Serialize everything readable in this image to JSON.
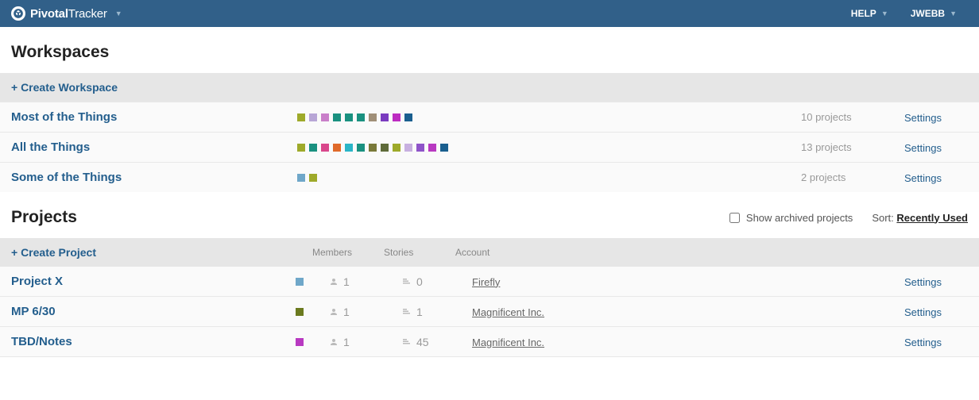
{
  "topbar": {
    "brand_bold": "Pivotal",
    "brand_light": "Tracker",
    "help_label": "HELP",
    "user_label": "JWEBB"
  },
  "workspaces": {
    "title": "Workspaces",
    "create_label": "+ Create Workspace",
    "settings_label": "Settings",
    "rows": [
      {
        "name": "Most of the Things",
        "count_text": "10 projects",
        "colors": [
          "#9eaa2a",
          "#b8a6d6",
          "#c97fc9",
          "#1a9180",
          "#1a9180",
          "#1a9180",
          "#a08f78",
          "#7a3bbf",
          "#bd2cc1",
          "#1a5f8f"
        ]
      },
      {
        "name": "All the Things",
        "count_text": "13 projects",
        "colors": [
          "#9eaa2a",
          "#1a9180",
          "#d9478c",
          "#e06a2b",
          "#2ab5c7",
          "#1a9180",
          "#7a7a3a",
          "#5f6b3a",
          "#9eaa2a",
          "#c8b0e0",
          "#8f54c9",
          "#b839c1",
          "#1a5f8f"
        ]
      },
      {
        "name": "Some of the Things",
        "count_text": "2 projects",
        "colors": [
          "#6fa7c9",
          "#9eaa2a"
        ]
      }
    ]
  },
  "projects": {
    "title": "Projects",
    "create_label": "+ Create Project",
    "archived_label": "Show archived projects",
    "archived_checked": false,
    "sort_label": "Sort:",
    "sort_value": "Recently Used",
    "settings_label": "Settings",
    "headers": {
      "members": "Members",
      "stories": "Stories",
      "account": "Account"
    },
    "rows": [
      {
        "name": "Project X",
        "color": "#6fa7c9",
        "members": "1",
        "stories": "0",
        "account": "Firefly"
      },
      {
        "name": "MP 6/30",
        "color": "#6b7a1f",
        "members": "1",
        "stories": "1",
        "account": "Magnificent Inc."
      },
      {
        "name": "TBD/Notes",
        "color": "#b839c1",
        "members": "1",
        "stories": "45",
        "account": "Magnificent Inc."
      }
    ]
  }
}
